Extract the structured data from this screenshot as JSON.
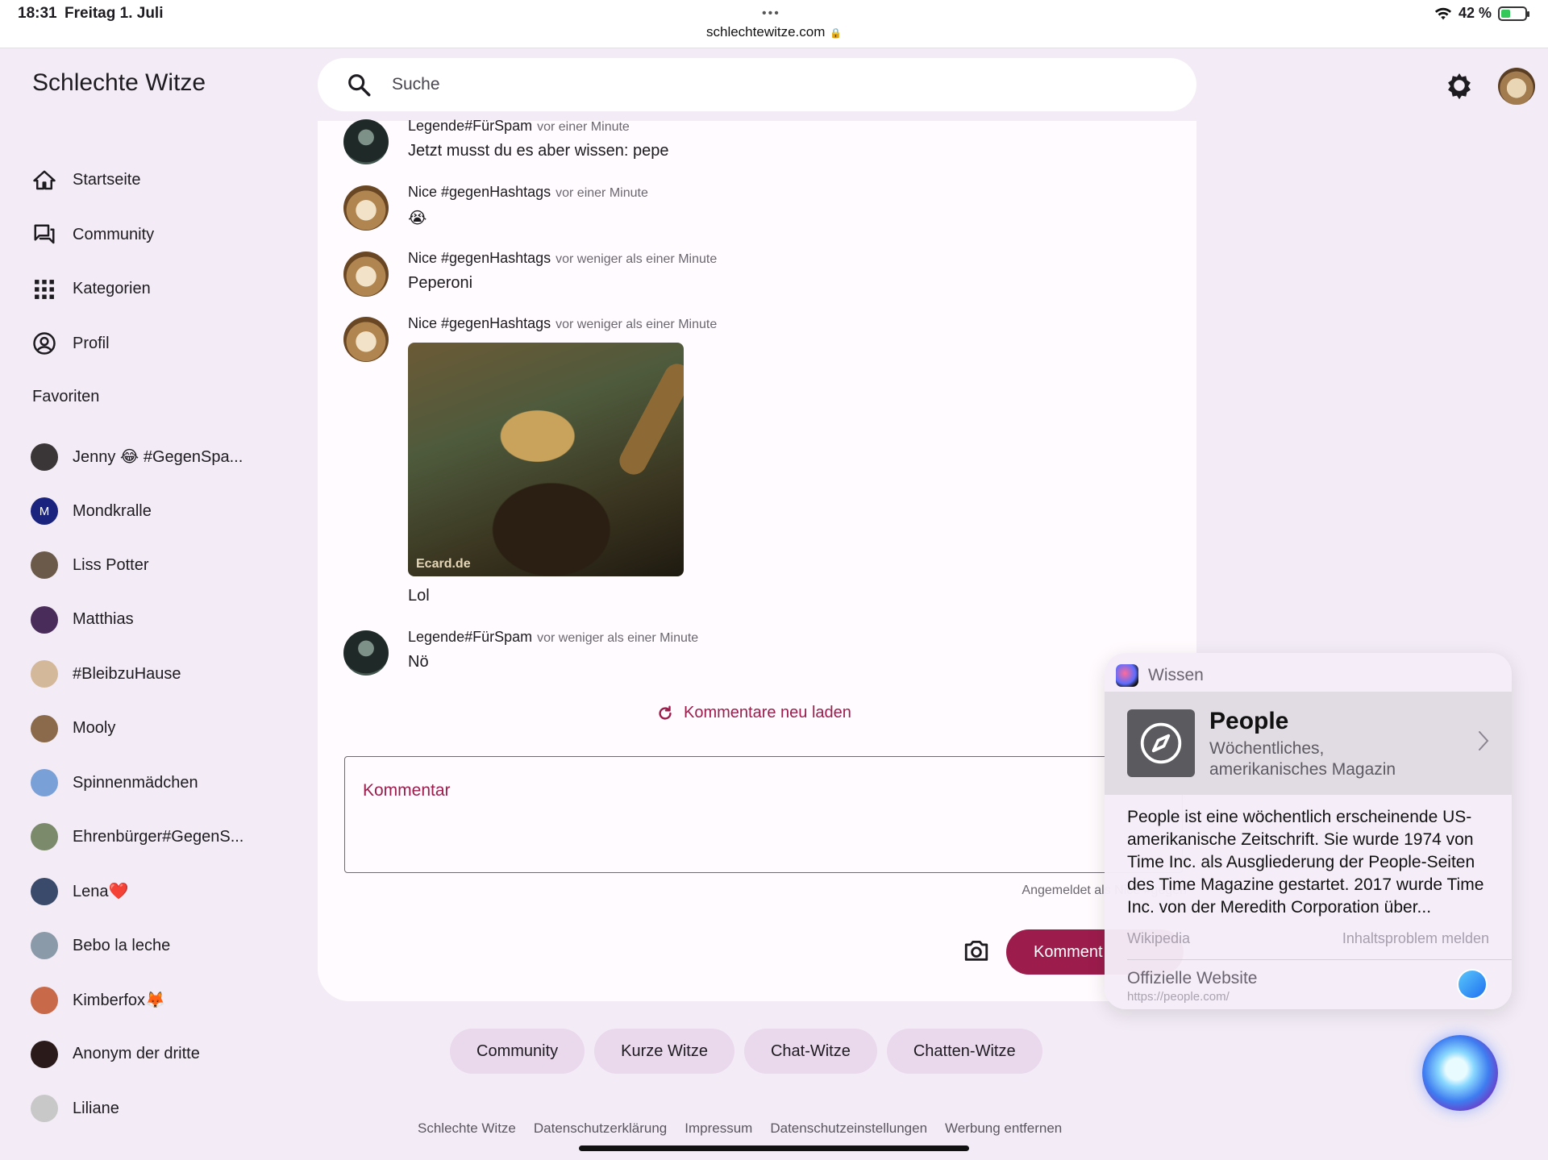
{
  "status_bar": {
    "time": "18:31",
    "date": "Freitag 1. Juli",
    "dots": "•••",
    "url": "schlechtewitze.com",
    "battery": "42 %",
    "battery_level_percent": 42
  },
  "app": {
    "title": "Schlechte Witze"
  },
  "search": {
    "placeholder": "Suche"
  },
  "nav": {
    "items": [
      {
        "label": "Startseite",
        "icon": "home-icon"
      },
      {
        "label": "Community",
        "icon": "forum-icon"
      },
      {
        "label": "Kategorien",
        "icon": "grid-icon"
      },
      {
        "label": "Profil",
        "icon": "account-circle-icon"
      }
    ]
  },
  "favorites": {
    "title": "Favoriten",
    "items": [
      {
        "label": "Jenny 😂 #GegenSpa...",
        "color": "#3a3536"
      },
      {
        "label": "Mondkralle",
        "initial": "M",
        "color": "#1a237e"
      },
      {
        "label": "Liss Potter",
        "color": "#6b5a4a"
      },
      {
        "label": "Matthias",
        "color": "#4a2c5a"
      },
      {
        "label": "#BleibzuHause",
        "color": "#d4b89a"
      },
      {
        "label": "Mooly",
        "color": "#8a6a4a"
      },
      {
        "label": "Spinnenmädchen",
        "color": "#7aa0d8"
      },
      {
        "label": "Ehrenbürger#GegenS...",
        "color": "#7a8a6a"
      },
      {
        "label": "Lena❤️",
        "color": "#3a4a6a"
      },
      {
        "label": "Bebo la leche",
        "color": "#8a9aa8"
      },
      {
        "label": "Kimberfox🦊",
        "color": "#c86a4a"
      },
      {
        "label": "Anonym der dritte",
        "color": "#2a1a1a"
      },
      {
        "label": "Liliane",
        "color": "#c8c8c8"
      }
    ]
  },
  "comments": [
    {
      "author": "Legende#FürSpam",
      "time": "vor einer Minute",
      "text": "Jetzt musst du es aber wissen: pepe",
      "avatar": "legend"
    },
    {
      "author": "Nice #gegenHashtags",
      "time": "vor einer Minute",
      "text": "😭",
      "avatar": "cat"
    },
    {
      "author": "Nice #gegenHashtags",
      "time": "vor weniger als einer Minute",
      "text": "Peperoni",
      "avatar": "cat"
    },
    {
      "author": "Nice #gegenHashtags",
      "time": "vor weniger als einer Minute",
      "text": "Lol",
      "avatar": "cat",
      "image_watermark": "Ecard.de"
    },
    {
      "author": "Legende#FürSpam",
      "time": "vor weniger als einer Minute",
      "text": "Nö",
      "avatar": "legend"
    }
  ],
  "reload": {
    "label": "Kommentare neu laden"
  },
  "composer": {
    "placeholder": "Kommentar",
    "signed_in": "Angemeldet als Nice #gegen",
    "submit_label": "Komment"
  },
  "chips": [
    "Community",
    "Kurze Witze",
    "Chat-Witze",
    "Chatten-Witze"
  ],
  "footer": [
    "Schlechte Witze",
    "Datenschutzerklärung",
    "Impressum",
    "Datenschutzeinstellungen",
    "Werbung entfernen"
  ],
  "siri": {
    "header": "Wissen",
    "name": "People",
    "subtitle": "Wöchentliches, amerikanisches Magazin",
    "text": "People ist eine wöchentlich erscheinende US-amerikanische Zeitschrift. Sie wurde 1974 von Time Inc. als Ausgliederung der People-Seiten des Time Magazine gestartet. 2017 wurde Time Inc. von der Meredith Corporation über...",
    "source": "Wikipedia",
    "report": "Inhaltsproblem melden",
    "website_label": "Offizielle Website",
    "website_url": "https://people.com/"
  },
  "colors": {
    "accent": "#9c1c4c",
    "background": "#f3ecf6",
    "card": "#fffbfe",
    "chip": "#ead8ec"
  }
}
